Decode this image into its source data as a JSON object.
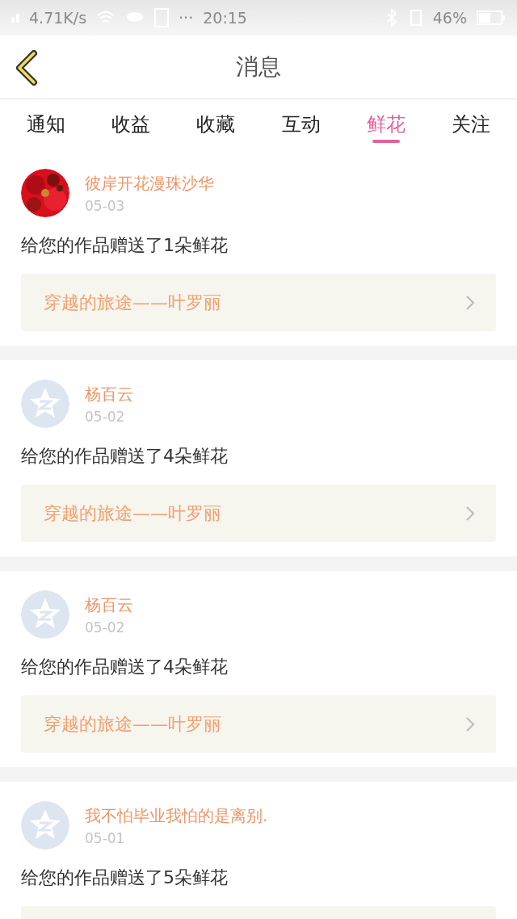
{
  "status_bar": {
    "speed": "4.71K/s",
    "more": "···",
    "time": "20:15",
    "battery": "46%"
  },
  "header": {
    "title": "消息"
  },
  "tabs": [
    {
      "label": "通知",
      "selected": false
    },
    {
      "label": "收益",
      "selected": false
    },
    {
      "label": "收藏",
      "selected": false
    },
    {
      "label": "互动",
      "selected": false
    },
    {
      "label": "鲜花",
      "selected": true
    },
    {
      "label": "关注",
      "selected": false
    }
  ],
  "messages": [
    {
      "name": "彼岸开花漫珠沙华",
      "date": "05-03",
      "text": "给您的作品赠送了1朵鲜花",
      "work": "穿越的旅途——叶罗丽"
    },
    {
      "kind": "default",
      "name": "杨百云",
      "date": "05-02",
      "text": "给您的作品赠送了4朵鲜花",
      "work": "穿越的旅途——叶罗丽"
    },
    {
      "kind": "default",
      "name": "杨百云",
      "date": "05-02",
      "text": "给您的作品赠送了4朵鲜花",
      "work": "穿越的旅途——叶罗丽"
    },
    {
      "kind": "default",
      "name": "我不怕毕业我怕的是离别.",
      "date": "05-01",
      "text": "给您的作品赠送了5朵鲜花"
    }
  ]
}
